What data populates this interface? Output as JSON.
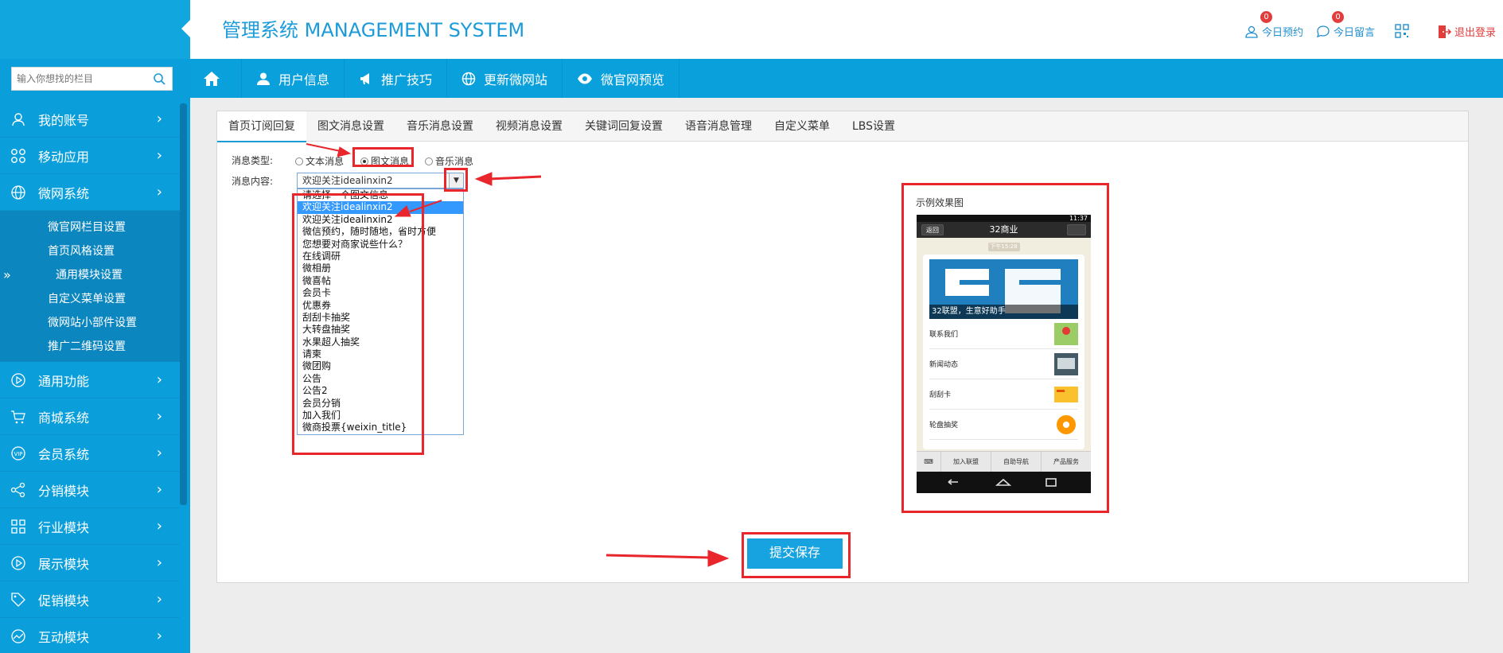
{
  "app": {
    "title": "管理系统 MANAGEMENT SYSTEM"
  },
  "header": {
    "today_appointments": "今日预约",
    "today_appointments_count": "0",
    "today_messages": "今日留言",
    "today_messages_count": "0",
    "logout": "退出登录"
  },
  "sidebar": {
    "search_placeholder": "输入你想找的栏目",
    "items": [
      {
        "label": "我的账号",
        "icon": "user-icon"
      },
      {
        "label": "移动应用",
        "icon": "apps-icon"
      },
      {
        "label": "微网系统",
        "icon": "globe-icon"
      }
    ],
    "subitems": [
      {
        "label": "微官网栏目设置"
      },
      {
        "label": "首页风格设置"
      },
      {
        "label": "通用模块设置"
      },
      {
        "label": "自定义菜单设置"
      },
      {
        "label": "微网站小部件设置"
      },
      {
        "label": "推广二维码设置"
      }
    ],
    "items_after": [
      {
        "label": "通用功能",
        "icon": "play-icon"
      },
      {
        "label": "商城系统",
        "icon": "cart-icon"
      },
      {
        "label": "会员系统",
        "icon": "vip-icon"
      },
      {
        "label": "分销模块",
        "icon": "share-icon"
      },
      {
        "label": "行业模块",
        "icon": "grid-icon"
      },
      {
        "label": "展示模块",
        "icon": "play-circle-icon"
      },
      {
        "label": "促销模块",
        "icon": "tag-icon"
      },
      {
        "label": "互动模块",
        "icon": "chart-icon"
      }
    ]
  },
  "topnav": {
    "items": [
      {
        "label": "用户信息",
        "icon": "user-icon"
      },
      {
        "label": "推广技巧",
        "icon": "megaphone-icon"
      },
      {
        "label": "更新微网站",
        "icon": "globe-icon"
      },
      {
        "label": "微官网预览",
        "icon": "eye-icon"
      }
    ]
  },
  "tabs": [
    {
      "label": "首页订阅回复"
    },
    {
      "label": "图文消息设置"
    },
    {
      "label": "音乐消息设置"
    },
    {
      "label": "视频消息设置"
    },
    {
      "label": "关键词回复设置"
    },
    {
      "label": "语音消息管理"
    },
    {
      "label": "自定义菜单"
    },
    {
      "label": "LBS设置"
    }
  ],
  "form": {
    "type_label": "消息类型:",
    "content_label": "消息内容:",
    "radio_text": "文本消息",
    "radio_news": "图文消息",
    "radio_music": "音乐消息",
    "selected_value": "欢迎关注idealinxin2",
    "options": [
      "请选择一个图文信息",
      "欢迎关注idealinxin2",
      "欢迎关注idealinxin2",
      "微信预约，随时随地，省时方便",
      "您想要对商家说些什么？",
      "在线调研",
      "微相册",
      "微喜帖",
      "会员卡",
      "优惠券",
      "刮刮卡抽奖",
      "大转盘抽奖",
      "水果超人抽奖",
      "请柬",
      "微团购",
      "公告",
      "公告2",
      "会员分销",
      "加入我们",
      "微商投票{weixin_title}"
    ],
    "submit": "提交保存"
  },
  "preview": {
    "label": "示例效果图",
    "status_time": "11:37",
    "back": "返回",
    "title": "32商业",
    "time_chip": "下午15:28",
    "banner_caption": "32联盟，生意好助手",
    "rows": [
      "联系我们",
      "新闻动态",
      "刮刮卡",
      "轮盘抽奖"
    ],
    "bottom_tabs": [
      "加入联盟",
      "自助导航",
      "产品服务"
    ]
  }
}
